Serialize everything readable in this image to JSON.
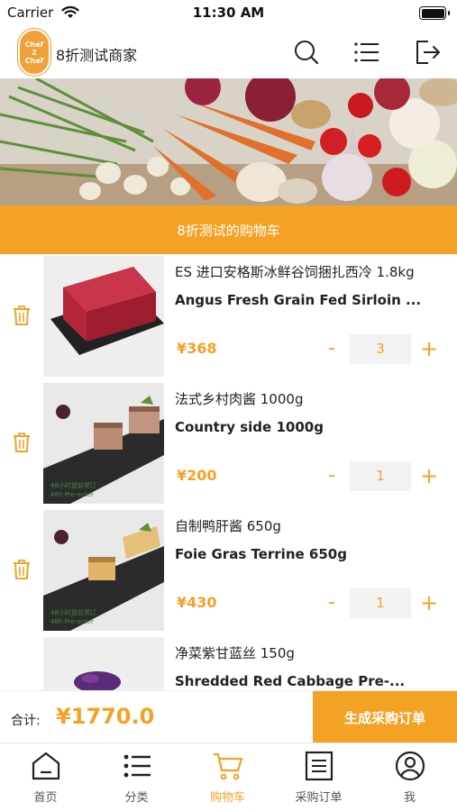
{
  "status_bar": {
    "carrier": "Carrier",
    "time": "11:30 AM"
  },
  "header": {
    "logo_text": "Chef\n2\nChef",
    "merchant_name": "8折测试商家",
    "icons": [
      "search-icon",
      "list-icon",
      "logout-icon"
    ]
  },
  "cart": {
    "title": "8折测试的购物车",
    "items": [
      {
        "name_cn": "ES 进口安格斯冰鲜谷饲捆扎西冷 1.8kg",
        "name_en": "Angus Fresh Grain Fed Sirloin ...",
        "price": "¥368",
        "qty": "3",
        "image_caption_cn": "",
        "image_caption_en": ""
      },
      {
        "name_cn": "法式乡村肉酱 1000g",
        "name_en": "Country side 1000g",
        "price": "¥200",
        "qty": "1",
        "image_caption_cn": "48小时提前预订",
        "image_caption_en": "48h Pre-order"
      },
      {
        "name_cn": "自制鸭肝酱 650g",
        "name_en": "Foie Gras Terrine 650g",
        "price": "¥430",
        "qty": "1",
        "image_caption_cn": "48小时提前预订",
        "image_caption_en": "48h Pre-order"
      },
      {
        "name_cn": "净菜紫甘蓝丝 150g",
        "name_en": "Shredded Red Cabbage Pre-...",
        "price": "",
        "qty": "",
        "image_caption_cn": "",
        "image_caption_en": ""
      }
    ],
    "minus_label": "-",
    "plus_label": "+"
  },
  "footer": {
    "total_label": "合计:",
    "total_value": "¥1770.0",
    "order_button": "生成采购订单"
  },
  "tabs": [
    {
      "label": "首页",
      "icon": "home-icon",
      "active": false
    },
    {
      "label": "分类",
      "icon": "category-list-icon",
      "active": false
    },
    {
      "label": "购物车",
      "icon": "cart-icon",
      "active": true
    },
    {
      "label": "采购订单",
      "icon": "order-document-icon",
      "active": false
    },
    {
      "label": "我",
      "icon": "profile-icon",
      "active": false
    }
  ],
  "colors": {
    "accent": "#f3a226",
    "text": "#222222",
    "qty_bg": "#f2f2f2"
  }
}
